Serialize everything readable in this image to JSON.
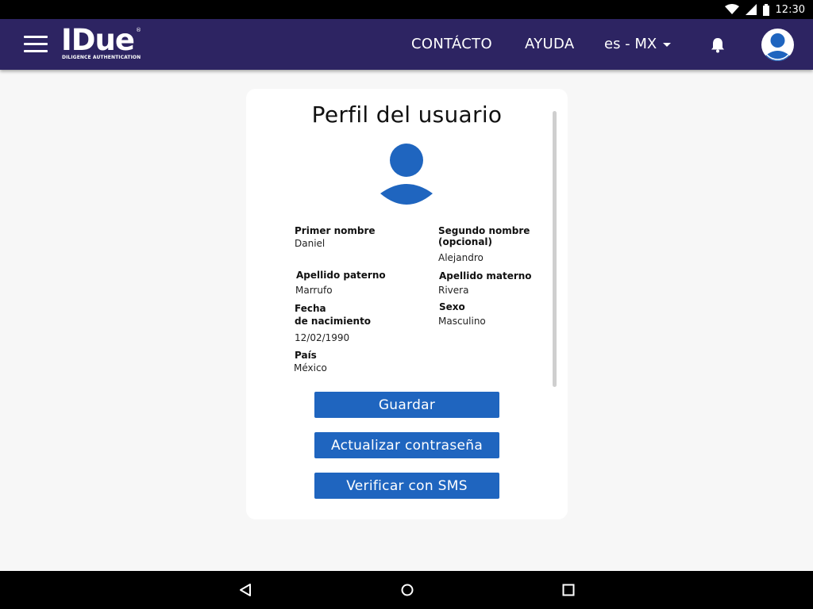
{
  "status_bar": {
    "time": "12:30",
    "icons": [
      "wifi-icon",
      "signal-icon",
      "battery-icon"
    ]
  },
  "header": {
    "logo_text": "IDue",
    "logo_registered": "®",
    "logo_subtitle": "DILIGENCE AUTHENTICATION",
    "nav": {
      "contacto": "CONTÁCTO",
      "ayuda": "AYUDA"
    },
    "language": "es - MX",
    "icons": [
      "menu-icon",
      "bell-icon",
      "user-avatar-icon"
    ]
  },
  "profile": {
    "title": "Perfil del usuario",
    "fields": {
      "primer_nombre": {
        "label": "Primer nombre",
        "value": "Daniel"
      },
      "segundo_nombre": {
        "label_line1": "Segundo nombre",
        "label_line2": "(opcional)",
        "value": "Alejandro"
      },
      "apellido_paterno": {
        "label": "Apellido paterno",
        "value": "Marrufo"
      },
      "apellido_materno": {
        "label": "Apellido materno",
        "value": "Rivera"
      },
      "fecha_nacimiento": {
        "label_line1": "Fecha",
        "label_line2": "de nacimiento",
        "value": "12/02/1990"
      },
      "sexo": {
        "label": "Sexo",
        "value": "Masculino"
      },
      "pais": {
        "label": "País",
        "value": "México"
      }
    },
    "buttons": {
      "guardar": "Guardar",
      "actualizar": "Actualizar contraseña",
      "verificar": "Verificar con SMS"
    }
  },
  "colors": {
    "header_bg": "#2d2462",
    "button_bg": "#1f65bf",
    "avatar_blue": "#1f65bf",
    "page_bg": "#f7f7f7"
  },
  "nav_bar_icons": [
    "back-icon",
    "home-icon",
    "recents-icon"
  ]
}
